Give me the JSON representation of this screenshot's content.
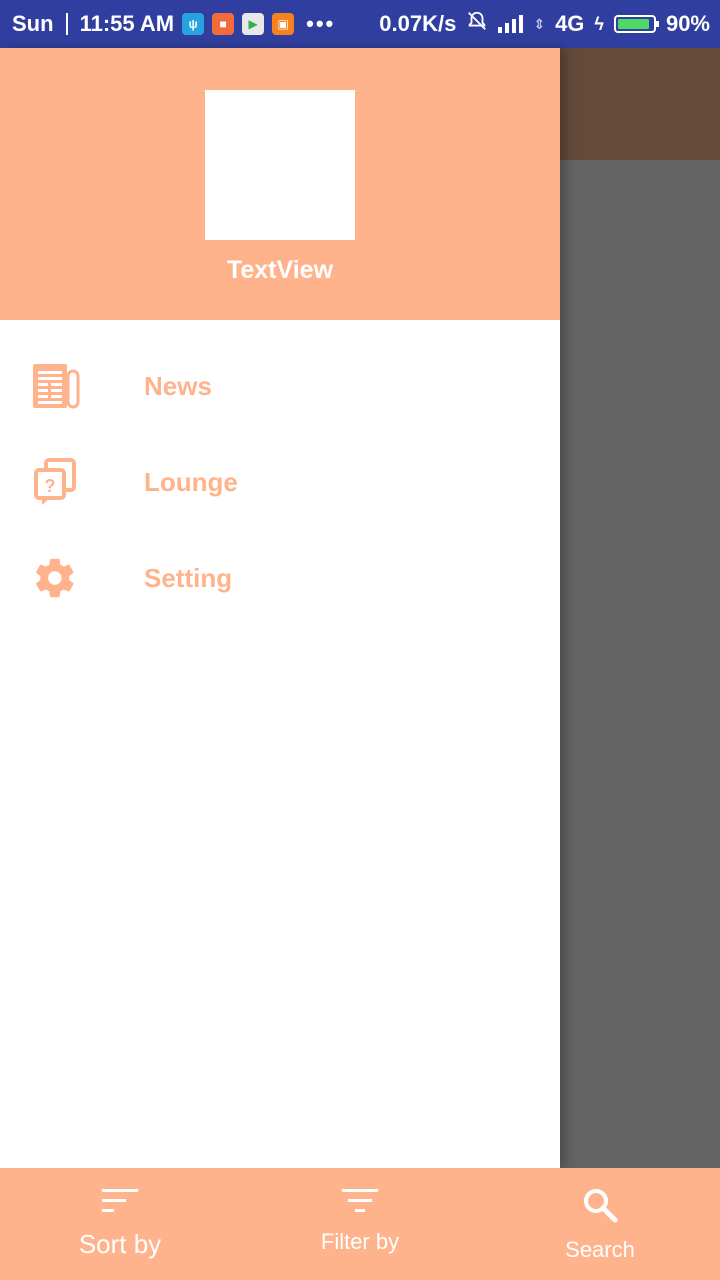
{
  "status_bar": {
    "day": "Sun",
    "time": "11:55 AM",
    "notification_icons": [
      "usb-icon",
      "mi-icon",
      "play-store-icon",
      "shopping-icon"
    ],
    "more": "•••",
    "speed": "0.07K/s",
    "network": "4G",
    "battery": "90%",
    "battery_level": 0.9
  },
  "drawer": {
    "header_title": "TextView",
    "items": [
      {
        "label": "News",
        "icon": "newspaper-icon"
      },
      {
        "label": "Lounge",
        "icon": "lounge-chat-icon"
      },
      {
        "label": "Setting",
        "icon": "gear-icon"
      }
    ]
  },
  "bottom_nav": {
    "items": [
      {
        "label": "Sort by",
        "icon": "sort-icon"
      },
      {
        "label": "Filter by",
        "icon": "filter-icon"
      },
      {
        "label": "Search",
        "icon": "search-icon"
      }
    ]
  },
  "colors": {
    "accent": "#ffb38c",
    "status_bar": "#303f9f",
    "scrim": "#646464"
  }
}
